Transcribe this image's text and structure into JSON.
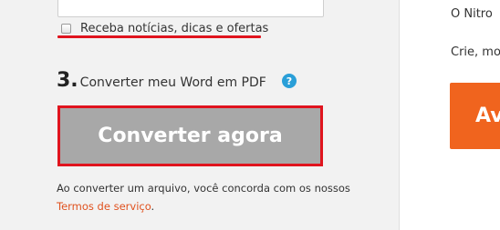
{
  "form": {
    "newsletter_label": "Receba notícias, dicas e ofertas",
    "step_number": "3.",
    "step_text": "Converter meu Word em PDF",
    "help_icon_glyph": "?",
    "convert_button_label": "Converter agora",
    "terms_prefix": "Ao converter um arquivo, você concorda com os nossos",
    "terms_link": "Termos de serviço",
    "terms_suffix": "."
  },
  "sidebar": {
    "line1": "O Nitro",
    "line2": "Crie, mo",
    "button_label": "Av"
  },
  "colors": {
    "highlight_red": "#e0141e",
    "button_gray": "#a8a8a8",
    "help_blue": "#2a9fd8",
    "link_orange": "#e0521f",
    "cta_orange": "#f0641e"
  }
}
